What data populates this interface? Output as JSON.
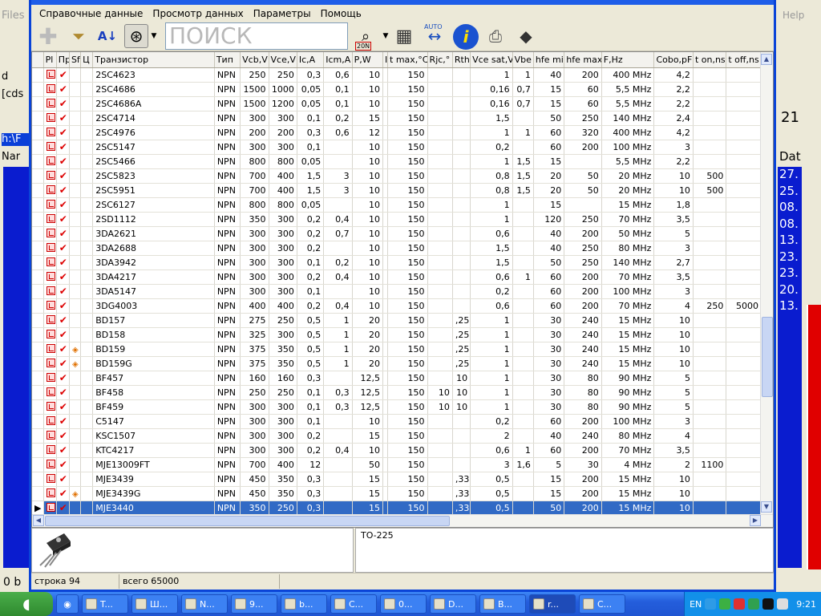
{
  "menu": [
    "Справочные данные",
    "Просмотр данных",
    "Параметры",
    "Помощь"
  ],
  "search": {
    "placeholder": "ПОИСК"
  },
  "toolbar": {
    "auto_label": "AUTO",
    "bin_label": "20N"
  },
  "bg_left": {
    "files": "Files",
    "items": [
      "d",
      "[cds",
      "h:\\F",
      "Nar"
    ]
  },
  "bg_right": {
    "help": "Help",
    "time_fragment": "21",
    "date_header": "Dat",
    "values": [
      "27.",
      "25.",
      "08.",
      "08.",
      "13.",
      "23.",
      "23.",
      "20.",
      "13."
    ]
  },
  "columns": [
    "Pl",
    "Пр",
    "Sf",
    "Ц",
    "Транзистор",
    "Тип",
    "Vcb,V",
    "Vce,V",
    "Ic,A",
    "Icm,A",
    "P,W",
    "I",
    "t max,°C",
    "Rjc,°",
    "Rth",
    "Vce sat,V",
    "Vbe",
    "hfe min",
    "hfe max",
    "F,Hz",
    "Cobo,pF",
    "t on,ns",
    "t off,ns"
  ],
  "rows": [
    [
      "2SC4623",
      "NPN",
      "250",
      "250",
      "0,3",
      "0,6",
      "10",
      "150",
      "",
      "",
      "1",
      "1",
      "40",
      "200",
      "400 MHz",
      "4,2",
      "",
      ""
    ],
    [
      "2SC4686",
      "NPN",
      "1500",
      "1000",
      "0,05",
      "0,1",
      "10",
      "150",
      "",
      "",
      "0,16",
      "0,7",
      "15",
      "60",
      "5,5 MHz",
      "2,2",
      "",
      ""
    ],
    [
      "2SC4686A",
      "NPN",
      "1500",
      "1200",
      "0,05",
      "0,1",
      "10",
      "150",
      "",
      "",
      "0,16",
      "0,7",
      "15",
      "60",
      "5,5 MHz",
      "2,2",
      "",
      ""
    ],
    [
      "2SC4714",
      "NPN",
      "300",
      "300",
      "0,1",
      "0,2",
      "15",
      "150",
      "",
      "",
      "1,5",
      "",
      "50",
      "250",
      "140 MHz",
      "2,4",
      "",
      ""
    ],
    [
      "2SC4976",
      "NPN",
      "200",
      "200",
      "0,3",
      "0,6",
      "12",
      "150",
      "",
      "",
      "1",
      "1",
      "60",
      "320",
      "400 MHz",
      "4,2",
      "",
      ""
    ],
    [
      "2SC5147",
      "NPN",
      "300",
      "300",
      "0,1",
      "",
      "10",
      "150",
      "",
      "",
      "0,2",
      "",
      "60",
      "200",
      "100 MHz",
      "3",
      "",
      ""
    ],
    [
      "2SC5466",
      "NPN",
      "800",
      "800",
      "0,05",
      "",
      "10",
      "150",
      "",
      "",
      "1",
      "1,5",
      "15",
      "",
      "5,5 MHz",
      "2,2",
      "",
      ""
    ],
    [
      "2SC5823",
      "NPN",
      "700",
      "400",
      "1,5",
      "3",
      "10",
      "150",
      "",
      "",
      "0,8",
      "1,5",
      "20",
      "50",
      "20 MHz",
      "10",
      "500",
      ""
    ],
    [
      "2SC5951",
      "NPN",
      "700",
      "400",
      "1,5",
      "3",
      "10",
      "150",
      "",
      "",
      "0,8",
      "1,5",
      "20",
      "50",
      "20 MHz",
      "10",
      "500",
      ""
    ],
    [
      "2SC6127",
      "NPN",
      "800",
      "800",
      "0,05",
      "",
      "10",
      "150",
      "",
      "",
      "1",
      "",
      "15",
      "",
      "15 MHz",
      "1,8",
      "",
      ""
    ],
    [
      "2SD1112",
      "NPN",
      "350",
      "300",
      "0,2",
      "0,4",
      "10",
      "150",
      "",
      "",
      "1",
      "",
      "120",
      "250",
      "70 MHz",
      "3,5",
      "",
      ""
    ],
    [
      "3DA2621",
      "NPN",
      "300",
      "300",
      "0,2",
      "0,7",
      "10",
      "150",
      "",
      "",
      "0,6",
      "",
      "40",
      "200",
      "50 MHz",
      "5",
      "",
      ""
    ],
    [
      "3DA2688",
      "NPN",
      "300",
      "300",
      "0,2",
      "",
      "10",
      "150",
      "",
      "",
      "1,5",
      "",
      "40",
      "250",
      "80 MHz",
      "3",
      "",
      ""
    ],
    [
      "3DA3942",
      "NPN",
      "300",
      "300",
      "0,1",
      "0,2",
      "10",
      "150",
      "",
      "",
      "1,5",
      "",
      "50",
      "250",
      "140 MHz",
      "2,7",
      "",
      ""
    ],
    [
      "3DA4217",
      "NPN",
      "300",
      "300",
      "0,2",
      "0,4",
      "10",
      "150",
      "",
      "",
      "0,6",
      "1",
      "60",
      "200",
      "70 MHz",
      "3,5",
      "",
      ""
    ],
    [
      "3DA5147",
      "NPN",
      "300",
      "300",
      "0,1",
      "",
      "10",
      "150",
      "",
      "",
      "0,2",
      "",
      "60",
      "200",
      "100 MHz",
      "3",
      "",
      ""
    ],
    [
      "3DG4003",
      "NPN",
      "400",
      "400",
      "0,2",
      "0,4",
      "10",
      "150",
      "",
      "",
      "0,6",
      "",
      "60",
      "200",
      "70 MHz",
      "4",
      "250",
      "5000"
    ],
    [
      "BD157",
      "NPN",
      "275",
      "250",
      "0,5",
      "1",
      "20",
      "150",
      "",
      ",25",
      "1",
      "",
      "30",
      "240",
      "15 MHz",
      "10",
      "",
      ""
    ],
    [
      "BD158",
      "NPN",
      "325",
      "300",
      "0,5",
      "1",
      "20",
      "150",
      "",
      ",25",
      "1",
      "",
      "30",
      "240",
      "15 MHz",
      "10",
      "",
      ""
    ],
    [
      "BD159",
      "NPN",
      "375",
      "350",
      "0,5",
      "1",
      "20",
      "150",
      "",
      ",25",
      "1",
      "",
      "30",
      "240",
      "15 MHz",
      "10",
      "",
      ""
    ],
    [
      "BD159G",
      "NPN",
      "375",
      "350",
      "0,5",
      "1",
      "20",
      "150",
      "",
      ",25",
      "1",
      "",
      "30",
      "240",
      "15 MHz",
      "10",
      "",
      ""
    ],
    [
      "BF457",
      "NPN",
      "160",
      "160",
      "0,3",
      "",
      "12,5",
      "150",
      "",
      "10",
      "1",
      "",
      "30",
      "80",
      "90 MHz",
      "5",
      "",
      ""
    ],
    [
      "BF458",
      "NPN",
      "250",
      "250",
      "0,1",
      "0,3",
      "12,5",
      "150",
      "10",
      "10",
      "1",
      "",
      "30",
      "80",
      "90 MHz",
      "5",
      "",
      ""
    ],
    [
      "BF459",
      "NPN",
      "300",
      "300",
      "0,1",
      "0,3",
      "12,5",
      "150",
      "10",
      "10",
      "1",
      "",
      "30",
      "80",
      "90 MHz",
      "5",
      "",
      ""
    ],
    [
      "C5147",
      "NPN",
      "300",
      "300",
      "0,1",
      "",
      "10",
      "150",
      "",
      "",
      "0,2",
      "",
      "60",
      "200",
      "100 MHz",
      "3",
      "",
      ""
    ],
    [
      "KSC1507",
      "NPN",
      "300",
      "300",
      "0,2",
      "",
      "15",
      "150",
      "",
      "",
      "2",
      "",
      "40",
      "240",
      "80 MHz",
      "4",
      "",
      ""
    ],
    [
      "KTC4217",
      "NPN",
      "300",
      "300",
      "0,2",
      "0,4",
      "10",
      "150",
      "",
      "",
      "0,6",
      "1",
      "60",
      "200",
      "70 MHz",
      "3,5",
      "",
      ""
    ],
    [
      "MJE13009FT",
      "NPN",
      "700",
      "400",
      "12",
      "",
      "50",
      "150",
      "",
      "",
      "3",
      "1,6",
      "5",
      "30",
      "4 MHz",
      "2",
      "1100",
      ""
    ],
    [
      "MJE3439",
      "NPN",
      "450",
      "350",
      "0,3",
      "",
      "15",
      "150",
      "",
      ",33",
      "0,5",
      "",
      "15",
      "200",
      "15 MHz",
      "10",
      "",
      ""
    ],
    [
      "MJE3439G",
      "NPN",
      "450",
      "350",
      "0,3",
      "",
      "15",
      "150",
      "",
      ",33",
      "0,5",
      "",
      "15",
      "200",
      "15 MHz",
      "10",
      "",
      ""
    ],
    [
      "MJE3440",
      "NPN",
      "350",
      "250",
      "0,3",
      "",
      "15",
      "150",
      "",
      ",33",
      "0,5",
      "",
      "50",
      "200",
      "15 MHz",
      "10",
      "",
      ""
    ]
  ],
  "sf_marked_rows": [
    19,
    20,
    29
  ],
  "selected_row": 30,
  "package": {
    "name": "TO-225"
  },
  "status": {
    "row": "строка 94",
    "total": "всего 65000",
    "left_fragment": "0 b"
  },
  "taskbar": {
    "tasks": [
      "T...",
      "Ш...",
      "N...",
      "9...",
      "b...",
      "C...",
      "0...",
      "D...",
      "B...",
      "r...",
      "C..."
    ],
    "active_task": 9,
    "lang": "EN",
    "clock": "9:21"
  }
}
